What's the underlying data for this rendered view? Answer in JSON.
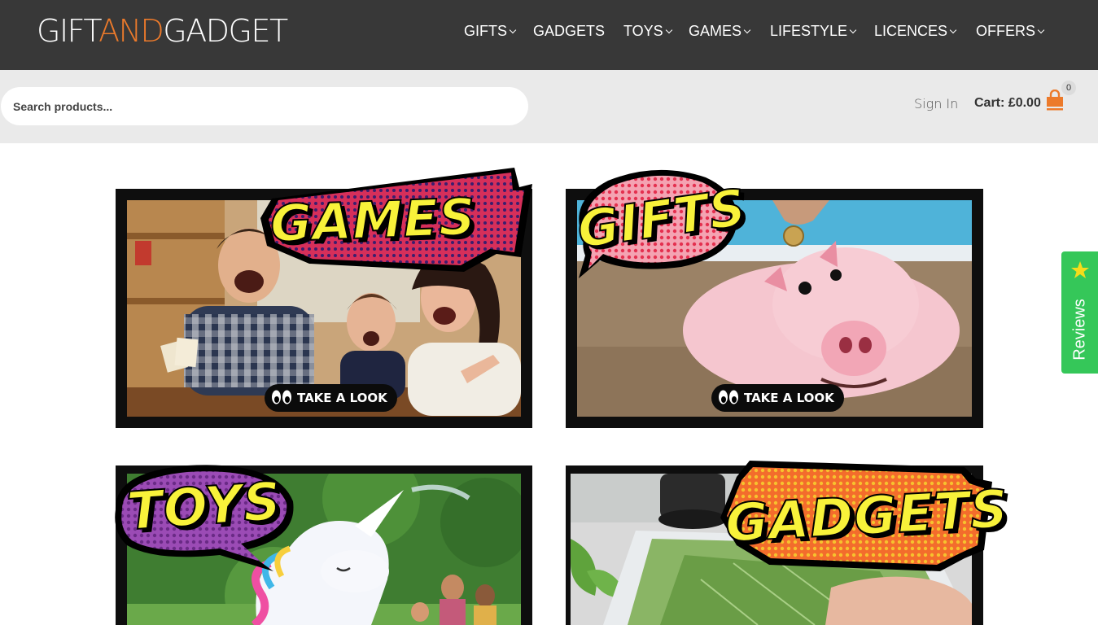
{
  "header": {
    "logo": {
      "part1": "GIFT",
      "part2": "AND",
      "part3": "GADGET",
      "accent_color": "#ec7a2b"
    },
    "nav": [
      {
        "label": "GIFTS",
        "has_dropdown": true
      },
      {
        "label": "GADGETS",
        "has_dropdown": false
      },
      {
        "label": "TOYS",
        "has_dropdown": true
      },
      {
        "label": "GAMES",
        "has_dropdown": true
      },
      {
        "label": "LIFESTYLE",
        "has_dropdown": true
      },
      {
        "label": "LICENCES",
        "has_dropdown": true
      },
      {
        "label": "OFFERS",
        "has_dropdown": true
      }
    ],
    "background_color": "#383838"
  },
  "search": {
    "placeholder": "Search products...",
    "value": ""
  },
  "account": {
    "signin_label": "Sign In"
  },
  "cart": {
    "label": "Cart:",
    "total": "£0.00",
    "count": "0",
    "icon": "shopping-bag-icon",
    "icon_color": "#ec7a2b"
  },
  "categories": [
    {
      "title": "GAMES",
      "cta": "TAKE A LOOK",
      "burst_color": "#d62f5a"
    },
    {
      "title": "GIFTS",
      "cta": "TAKE A LOOK",
      "burst_color": "#e8405e"
    },
    {
      "title": "TOYS",
      "cta": "",
      "burst_color": "#8c3fa6"
    },
    {
      "title": "GADGETS",
      "cta": "",
      "burst_color": "#ef6a2a"
    }
  ],
  "reviews_tab": {
    "label": "Reviews",
    "icon": "star-icon",
    "color": "#35c759"
  }
}
